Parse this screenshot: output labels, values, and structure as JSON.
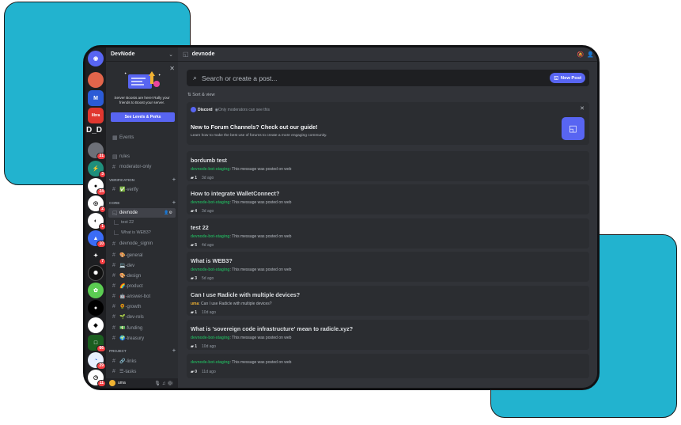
{
  "server": {
    "name": "DevNode"
  },
  "guild_rail": {
    "items": [
      {
        "name": "discord-home-icon",
        "text": "",
        "color": "#5865f2",
        "badge": ""
      },
      {
        "name": "server-icon",
        "text": "",
        "color": "#e2654b",
        "badge": ""
      },
      {
        "name": "server-icon",
        "text": "M",
        "color": "#2b5bd6",
        "badge": ""
      },
      {
        "name": "server-icon",
        "text": "libra",
        "color": "#e0372f",
        "badge": ""
      },
      {
        "name": "server-icon",
        "text": "",
        "color": "#3a3d44",
        "badge": "31"
      },
      {
        "name": "server-icon",
        "text": "",
        "color": "#1f8f7c",
        "badge": "3"
      },
      {
        "name": "server-icon",
        "text": "",
        "color": "#ffffff",
        "badge": "24"
      },
      {
        "name": "server-icon",
        "text": "",
        "color": "#ffffff",
        "badge": "2"
      },
      {
        "name": "server-icon",
        "text": "",
        "color": "#ffffff",
        "badge": "1"
      },
      {
        "name": "server-icon",
        "text": "",
        "color": "#3b6cf6",
        "badge": "10"
      },
      {
        "name": "server-icon",
        "text": "",
        "color": "#1e1f22",
        "badge": "7"
      },
      {
        "name": "server-icon",
        "text": "",
        "color": "#111111",
        "badge": ""
      },
      {
        "name": "server-icon",
        "text": "",
        "color": "#5bcc52",
        "badge": ""
      },
      {
        "name": "server-icon",
        "text": "",
        "color": "#000000",
        "badge": ""
      },
      {
        "name": "server-icon",
        "text": "",
        "color": "#ffffff",
        "badge": ""
      },
      {
        "name": "server-icon",
        "text": "",
        "color": "#1b5e20",
        "badge": "66"
      },
      {
        "name": "server-icon",
        "text": "",
        "color": "#e8f0ff",
        "badge": "29"
      },
      {
        "name": "server-icon",
        "text": "",
        "color": "#ffffff",
        "badge": "11"
      }
    ],
    "dnd_label": "D_D"
  },
  "boost": {
    "text": "Server Boosts are here! Rally your friends to Boost your server.",
    "button": "See Levels & Perks"
  },
  "sidebar": {
    "events": "Events",
    "rules": "rules",
    "moderator_only": "moderator-only",
    "cat_verification": "VERIFICATION",
    "verify": "✅-verify",
    "cat_core": "CORE",
    "devnode": "devnode",
    "thread_test22": "test 22",
    "thread_web3": "What is WEB3?",
    "devnode_signin": "devnode_signin",
    "general": "🎨-general",
    "dev": "💻-dev",
    "design": "🎨-design",
    "product": "🌈-product",
    "answer_bot": "🤖-answer-bot",
    "growth": "🌻-growth",
    "dev_rels": "🌱-dev-rels",
    "funding": "💵-funding",
    "treasury": "🌍-treasury",
    "cat_project": "PROJECT",
    "links": "🔗-links",
    "tasks": "☰-tasks",
    "user": "uma"
  },
  "main": {
    "channel_title": "devnode",
    "search_placeholder": "Search or create a post...",
    "new_post": "New Post",
    "sort_view": "Sort & view",
    "guide": {
      "source": "Discord",
      "visibility": "Only moderators can see this",
      "title": "New to Forum Channels? Check out our guide!",
      "subtitle": "Learn how to make the best use of forums to create a more engaging community."
    },
    "posts": [
      {
        "title": "bordumb test",
        "author": "devnode-bot-staging",
        "preview": " This message was posted on web",
        "count": "1",
        "age": "3d ago"
      },
      {
        "title": "How to integrate WalletConnect?",
        "author": "devnode-bot-staging",
        "preview": " This message was posted on web",
        "count": "4",
        "age": "3d ago"
      },
      {
        "title": "test 22",
        "author": "devnode-bot-staging",
        "preview": " This message was posted on web",
        "count": "5",
        "age": "4d ago"
      },
      {
        "title": "What is WEB3?",
        "author": "devnode-bot-staging",
        "preview": " This message was posted on web",
        "count": "3",
        "age": "5d ago"
      },
      {
        "title": "Can I use Radicle with multiple devices?",
        "author": "uma",
        "preview": " Can I use Radicle with multiple devices?",
        "count": "1",
        "age": "10d ago"
      },
      {
        "title": "What is 'sovereign code infrastructure' mean to radicle.xyz?",
        "author": "devnode-bot-staging",
        "preview": " This message was posted on web",
        "count": "1",
        "age": "10d ago"
      },
      {
        "title": "",
        "author": "devnode-bot-staging",
        "preview": " This message was posted on web",
        "count": "0",
        "age": "11d ago"
      }
    ]
  }
}
